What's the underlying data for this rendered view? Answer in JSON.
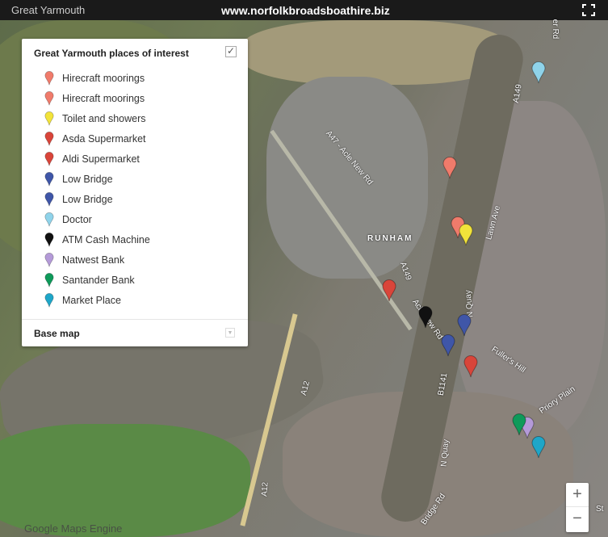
{
  "header": {
    "title": "Great Yarmouth",
    "site": "www.norfolkbroadsboathire.biz",
    "fullscreen_icon": "fullscreen-icon"
  },
  "legend": {
    "title": "Great Yarmouth places of interest",
    "checked": true,
    "check_glyph": "✓",
    "items": [
      {
        "label": "Hirecraft moorings",
        "color": "#f07b6b"
      },
      {
        "label": "Hirecraft moorings",
        "color": "#f07b6b"
      },
      {
        "label": "Toilet and showers",
        "color": "#f2e33a"
      },
      {
        "label": "Asda Supermarket",
        "color": "#d9453a"
      },
      {
        "label": "Aldi Supermarket",
        "color": "#d9453a"
      },
      {
        "label": "Low Bridge",
        "color": "#3f56a8"
      },
      {
        "label": "Low Bridge",
        "color": "#3f56a8"
      },
      {
        "label": "Doctor",
        "color": "#8fd3ea"
      },
      {
        "label": "ATM Cash Machine",
        "color": "#111111"
      },
      {
        "label": "Natwest Bank",
        "color": "#b49ad8"
      },
      {
        "label": "Santander Bank",
        "color": "#0e9a5a"
      },
      {
        "label": "Market Place",
        "color": "#1ea6c8"
      }
    ],
    "base_map_label": "Base map"
  },
  "map_labels": [
    "A47 - Acle New Rd",
    "RUNHAM",
    "A149",
    "Lawn Ave",
    "N Quay",
    "Acle New Rd",
    "B1141",
    "Fuller's Hill",
    "Priory Plain",
    "A12",
    "A12",
    "N Quay",
    "Bridge Rd",
    "A149",
    "er Rd",
    "St"
  ],
  "zoom": {
    "in": "+",
    "out": "−"
  },
  "attribution": "Google Maps Engine"
}
